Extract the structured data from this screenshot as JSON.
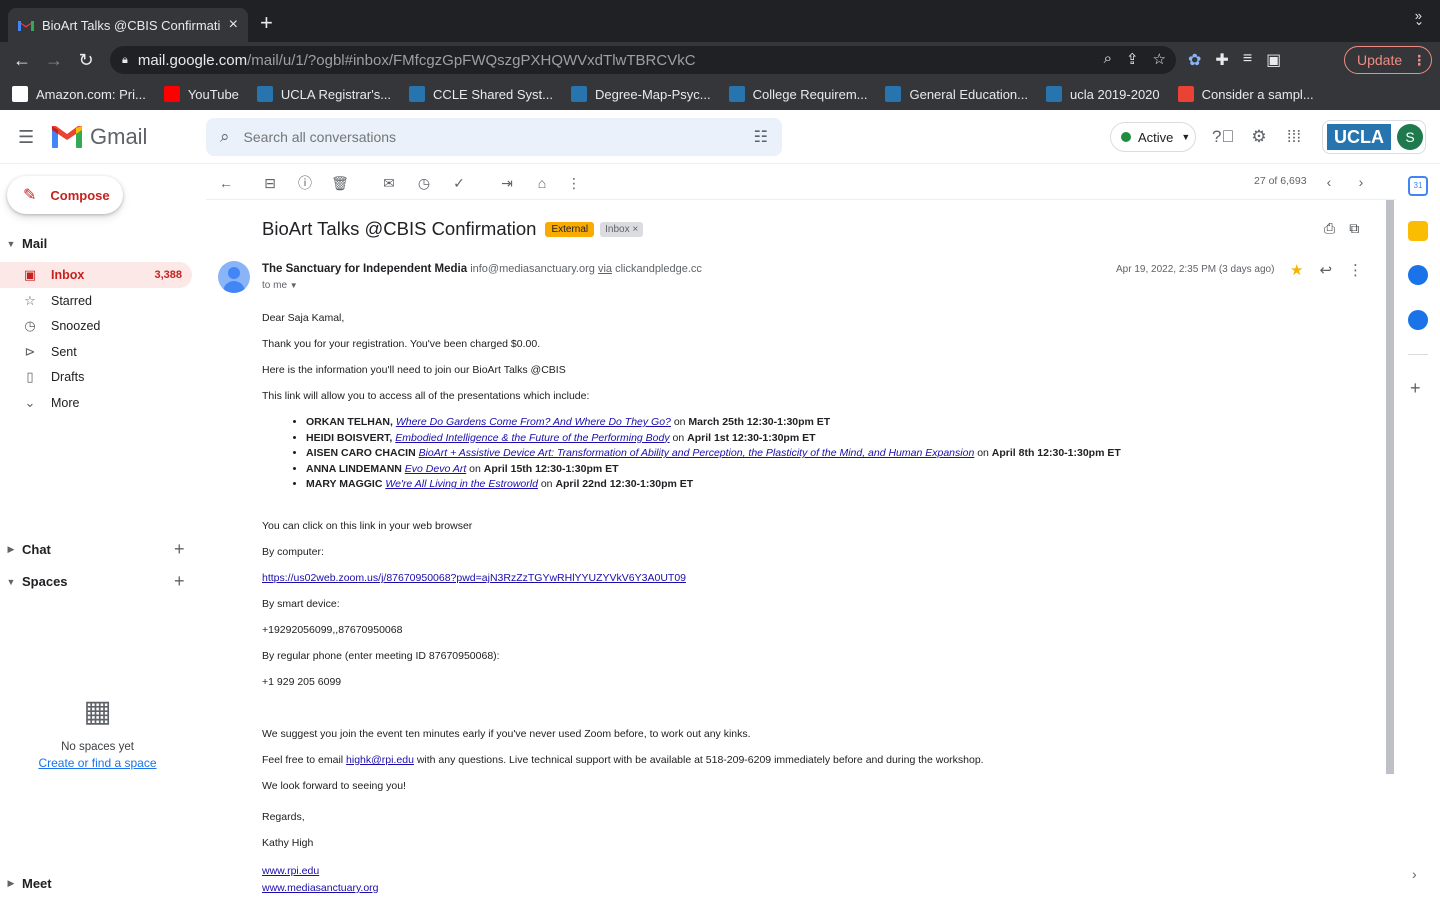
{
  "browser": {
    "tab_title": "BioArt Talks @CBIS Confirmation",
    "url_host": "mail.google.com",
    "url_path": "/mail/u/1/?ogbl#inbox/FMfcgzGpFWQszgPXHQWVxdTlwTBRCVkC",
    "update_label": "Update",
    "bookmarks": [
      {
        "label": "Amazon.com: Pri...",
        "color": "#ffffff"
      },
      {
        "label": "YouTube",
        "color": "#ff0000"
      },
      {
        "label": "UCLA Registrar's...",
        "color": "#2774ae"
      },
      {
        "label": "CCLE Shared Syst...",
        "color": "#2774ae"
      },
      {
        "label": "Degree-Map-Psyc...",
        "color": "#2774ae"
      },
      {
        "label": "College Requirem...",
        "color": "#2774ae"
      },
      {
        "label": "General Education...",
        "color": "#2774ae"
      },
      {
        "label": "ucla 2019-2020",
        "color": "#2774ae"
      },
      {
        "label": "Consider a sampl...",
        "color": "#ea4335"
      }
    ]
  },
  "gmail": {
    "brand": "Gmail",
    "search_placeholder": "Search all conversations",
    "status": "Active",
    "org_logo": "UCLA",
    "avatar_initial": "S",
    "compose_label": "Compose",
    "mail_section": "Mail",
    "nav": [
      {
        "label": "Inbox",
        "count": "3,388",
        "icon": "inbox-icon"
      },
      {
        "label": "Starred",
        "count": "",
        "icon": "star-icon"
      },
      {
        "label": "Snoozed",
        "count": "",
        "icon": "clock-icon"
      },
      {
        "label": "Sent",
        "count": "",
        "icon": "send-icon"
      },
      {
        "label": "Drafts",
        "count": "",
        "icon": "draft-icon"
      },
      {
        "label": "More",
        "count": "",
        "icon": "chevron-down-icon"
      }
    ],
    "chat_section": "Chat",
    "spaces_section": "Spaces",
    "no_spaces": "No spaces yet",
    "create_space": "Create or find a space",
    "meet_section": "Meet",
    "pager": "27 of 6,693"
  },
  "email": {
    "subject": "BioArt Talks @CBIS Confirmation",
    "label_external": "External",
    "label_inbox": "Inbox",
    "sender_name": "The Sanctuary for Independent Media",
    "sender_email": "info@mediasanctuary.org",
    "via": "via",
    "via_domain": "clickandpledge.cc",
    "to": "to me",
    "date": "Apr 19, 2022, 2:35 PM (3 days ago)",
    "greeting": "Dear Saja Kamal,",
    "line1": "Thank you for your registration. You've been charged $0.00.",
    "line2": "Here is the information you'll need to join our BioArt Talks @CBIS",
    "line3": "This link will allow you to access all of the presentations which include:",
    "talks": [
      {
        "name": "ORKAN TELHAN,",
        "title": "Where Do Gardens Come From? And Where Do They Go?",
        "on": " on ",
        "when": "March 25th 12:30-1:30pm ET"
      },
      {
        "name": "HEIDI BOISVERT,",
        "title": "Embodied Intelligence & the Future of the Performing Body",
        "on": " on ",
        "when": "April 1st 12:30-1:30pm ET"
      },
      {
        "name": "AISEN CARO CHACIN",
        "title": "BioArt + Assistive Device Art: Transformation of Ability and Perception, the Plasticity of the Mind, and Human Expansion",
        "on": " on ",
        "when": "April 8th 12:30-1:30pm ET"
      },
      {
        "name": "ANNA LINDEMANN",
        "title": "Evo Devo Art",
        "on": " on ",
        "when": "April 15th 12:30-1:30pm ET"
      },
      {
        "name": "MARY MAGGIC",
        "title": "We're All Living in the Estroworld",
        "on": " on ",
        "when": "April 22nd 12:30-1:30pm ET"
      }
    ],
    "line4": "You can click on this link in your web browser",
    "by_computer": "By computer:",
    "zoom_link": "https://us02web.zoom.us/j/87670950068?pwd=ajN3RzZzTGYwRHlYYUZYVkV6Y3A0UT09",
    "by_smart": "By smart device:",
    "smart_number": "+19292056099,,87670950068",
    "by_phone": "By regular phone (enter meeting ID 87670950068):",
    "phone_number": "+1 929 205 6099",
    "suggest": "We suggest you join the event ten minutes early if you've never used Zoom before, to work out any kinks.",
    "feel_free_pre": "Feel free to email ",
    "support_email": "highk@rpi.edu",
    "feel_free_post": " with any questions. Live technical support with be available at 518-209-6209 immediately before and during the workshop.",
    "look_forward": "We look forward to seeing you!",
    "regards": "Regards,",
    "signer": "Kathy High",
    "link_rpi": "www.rpi.edu",
    "link_ms": "www.mediasanctuary.org"
  }
}
